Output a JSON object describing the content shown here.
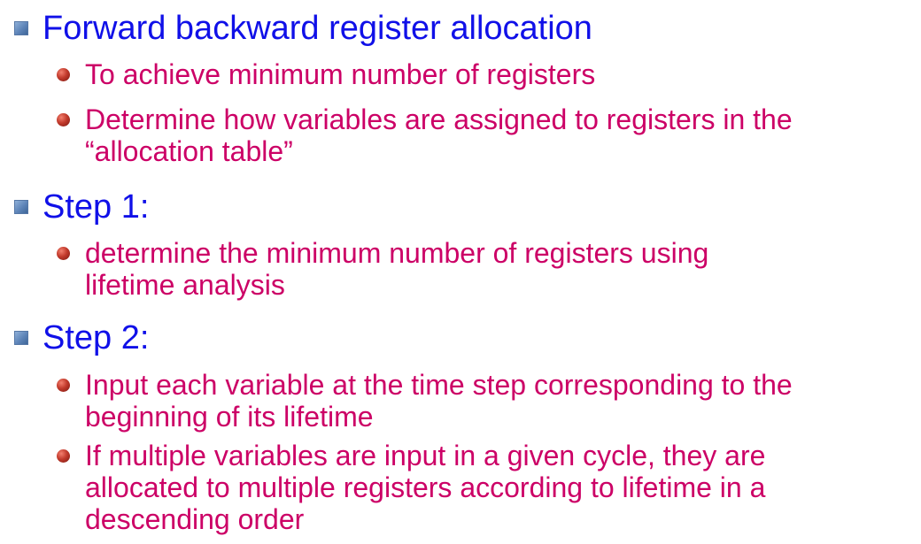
{
  "colors": {
    "heading": "#1010e8",
    "subtext": "#cc0066",
    "square_bullet": "#5d84b8",
    "round_bullet": "#b22a1d"
  },
  "sections": [
    {
      "heading": "Forward backward register allocation",
      "bullets": [
        {
          "lines": [
            "To achieve minimum number of registers"
          ]
        },
        {
          "lines": [
            "Determine how variables are assigned to registers in the",
            "“allocation table”"
          ]
        }
      ]
    },
    {
      "heading": "Step 1:",
      "bullets": [
        {
          "lines": [
            "determine the minimum number of registers using",
            "lifetime analysis"
          ]
        }
      ]
    },
    {
      "heading": "Step 2:",
      "bullets": [
        {
          "lines": [
            "Input each variable at the time step corresponding to the",
            "beginning of its lifetime"
          ]
        },
        {
          "lines": [
            "If multiple variables are input in a given cycle, they are",
            "allocated to multiple registers according to lifetime in a",
            "descending order"
          ]
        }
      ]
    }
  ]
}
